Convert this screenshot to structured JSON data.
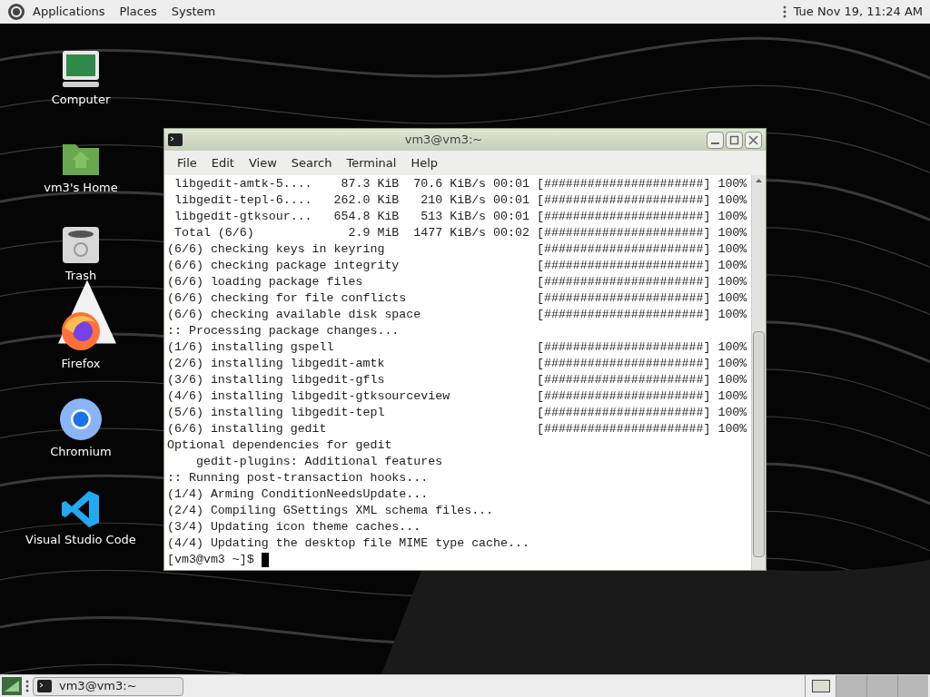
{
  "top_panel": {
    "menus": [
      "Applications",
      "Places",
      "System"
    ],
    "clock": "Tue Nov 19, 11:24 AM"
  },
  "desktop_icons": [
    {
      "kind": "computer",
      "label": "Computer"
    },
    {
      "kind": "home",
      "label": "vm3's Home"
    },
    {
      "kind": "trash",
      "label": "Trash"
    },
    {
      "kind": "firefox",
      "label": "Firefox"
    },
    {
      "kind": "chromium",
      "label": "Chromium"
    },
    {
      "kind": "vscode",
      "label": "Visual Studio Code"
    }
  ],
  "terminal_window": {
    "title": "vm3@vm3:~",
    "menu": [
      "File",
      "Edit",
      "View",
      "Search",
      "Terminal",
      "Help"
    ],
    "lines": [
      {
        "text": " libgedit-amtk-5....    87.3 KiB  70.6 KiB/s 00:01",
        "bar": "[######################]",
        "percent": "100%"
      },
      {
        "text": " libgedit-tepl-6....   262.0 KiB   210 KiB/s 00:01",
        "bar": "[######################]",
        "percent": "100%"
      },
      {
        "text": " libgedit-gtksour...   654.8 KiB   513 KiB/s 00:01",
        "bar": "[######################]",
        "percent": "100%"
      },
      {
        "text": " Total (6/6)             2.9 MiB  1477 KiB/s 00:02",
        "bar": "[######################]",
        "percent": "100%"
      },
      {
        "text": "(6/6) checking keys in keyring",
        "bar": "[######################]",
        "percent": "100%"
      },
      {
        "text": "(6/6) checking package integrity",
        "bar": "[######################]",
        "percent": "100%"
      },
      {
        "text": "(6/6) loading package files",
        "bar": "[######################]",
        "percent": "100%"
      },
      {
        "text": "(6/6) checking for file conflicts",
        "bar": "[######################]",
        "percent": "100%"
      },
      {
        "text": "(6/6) checking available disk space",
        "bar": "[######################]",
        "percent": "100%"
      },
      {
        "text": ":: Processing package changes..."
      },
      {
        "text": "(1/6) installing gspell",
        "bar": "[######################]",
        "percent": "100%"
      },
      {
        "text": "(2/6) installing libgedit-amtk",
        "bar": "[######################]",
        "percent": "100%"
      },
      {
        "text": "(3/6) installing libgedit-gfls",
        "bar": "[######################]",
        "percent": "100%"
      },
      {
        "text": "(4/6) installing libgedit-gtksourceview",
        "bar": "[######################]",
        "percent": "100%"
      },
      {
        "text": "(5/6) installing libgedit-tepl",
        "bar": "[######################]",
        "percent": "100%"
      },
      {
        "text": "(6/6) installing gedit",
        "bar": "[######################]",
        "percent": "100%"
      },
      {
        "text": "Optional dependencies for gedit"
      },
      {
        "text": "    gedit-plugins: Additional features"
      },
      {
        "text": ":: Running post-transaction hooks..."
      },
      {
        "text": "(1/4) Arming ConditionNeedsUpdate..."
      },
      {
        "text": "(2/4) Compiling GSettings XML schema files..."
      },
      {
        "text": "(3/4) Updating icon theme caches..."
      },
      {
        "text": "(4/4) Updating the desktop file MIME type cache..."
      }
    ],
    "prompt": "[vm3@vm3 ~]$"
  },
  "taskbar": {
    "tasks": [
      {
        "label": "vm3@vm3:~",
        "selected": false
      }
    ],
    "workspaces": [
      {
        "selected": true
      },
      {
        "selected": false
      },
      {
        "selected": false
      },
      {
        "selected": false
      }
    ]
  }
}
